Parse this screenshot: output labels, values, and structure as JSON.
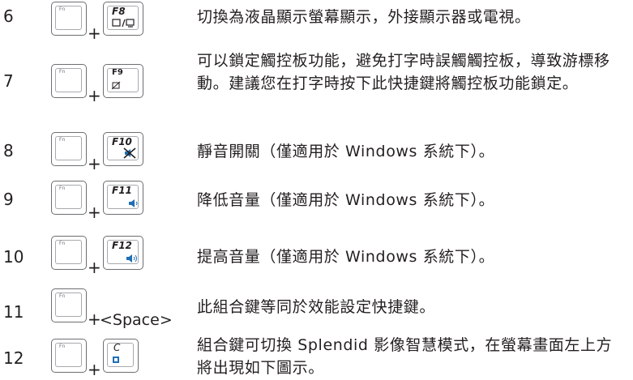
{
  "rows": [
    {
      "num": "6",
      "fn_label": "Fn",
      "key_label": "F8",
      "icon": "display-switch-icon",
      "desc": "切換為液晶顯示螢幕顯示，外接顯示器或電視。"
    },
    {
      "num": "7",
      "fn_label": "Fn",
      "key_label": "F9",
      "icon": "touchpad-lock-icon",
      "desc": "可以鎖定觸控板功能，避免打字時誤觸觸控板，導致游標移動。建議您在打字時按下此快捷鍵將觸控板功能鎖定。"
    },
    {
      "num": "8",
      "fn_label": "Fn",
      "key_label": "F10",
      "icon": "mute-icon",
      "desc": "靜音開關（僅適用於 Windows 系統下）。"
    },
    {
      "num": "9",
      "fn_label": "Fn",
      "key_label": "F11",
      "icon": "volume-down-icon",
      "desc": "降低音量（僅適用於 Windows 系統下）。"
    },
    {
      "num": "10",
      "fn_label": "Fn",
      "key_label": "F12",
      "icon": "volume-up-icon",
      "desc": "提高音量（僅適用於 Windows 系統下）。"
    },
    {
      "num": "11",
      "fn_label": "Fn",
      "key_label": "<Space>",
      "icon": "",
      "desc": "此組合鍵等同於效能設定快捷鍵。"
    },
    {
      "num": "12",
      "fn_label": "Fn",
      "key_label": "C",
      "icon": "splendid-icon",
      "desc": "組合鍵可切換 Splendid 影像智慧模式，在螢幕畫面左上方將出現如下圖示。"
    }
  ],
  "plus_sign": "+",
  "colors": {
    "text": "#231f20",
    "key_border": "#6d6e71",
    "icon_blue": "#1f6fb5"
  }
}
